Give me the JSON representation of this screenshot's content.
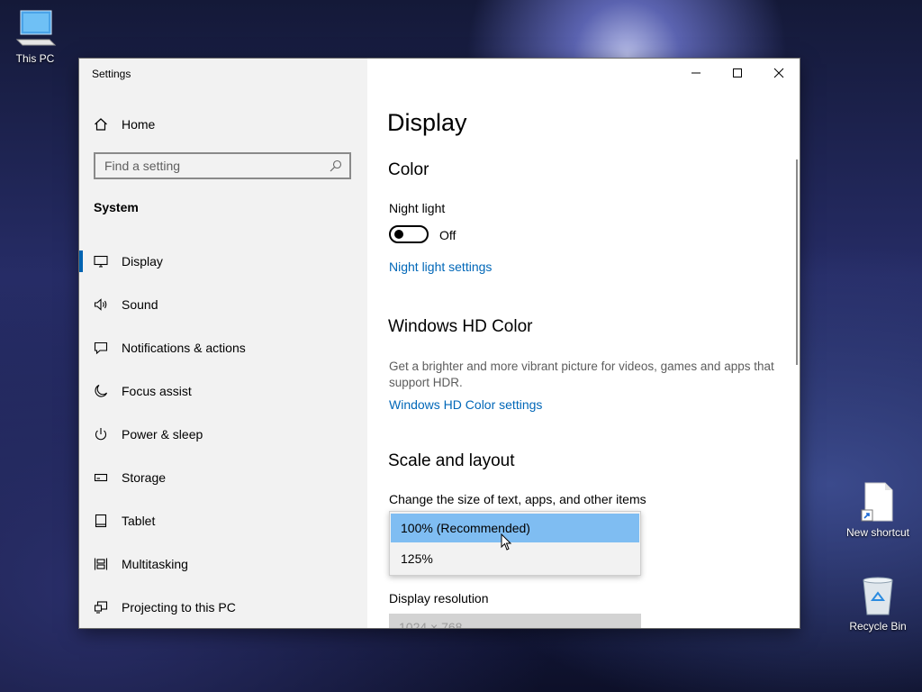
{
  "desktop": {
    "this_pc": "This PC",
    "new_shortcut": "New shortcut",
    "recycle_bin": "Recycle Bin"
  },
  "window": {
    "title": "Settings"
  },
  "sidebar": {
    "home": "Home",
    "search_placeholder": "Find a setting",
    "section": "System",
    "items": [
      {
        "label": "Display",
        "icon": "monitor-icon",
        "active": true
      },
      {
        "label": "Sound",
        "icon": "speaker-icon"
      },
      {
        "label": "Notifications & actions",
        "icon": "message-icon"
      },
      {
        "label": "Focus assist",
        "icon": "moon-icon"
      },
      {
        "label": "Power & sleep",
        "icon": "power-icon"
      },
      {
        "label": "Storage",
        "icon": "storage-icon"
      },
      {
        "label": "Tablet",
        "icon": "tablet-icon"
      },
      {
        "label": "Multitasking",
        "icon": "multitasking-icon"
      },
      {
        "label": "Projecting to this PC",
        "icon": "projector-icon"
      }
    ]
  },
  "content": {
    "title": "Display",
    "color_heading": "Color",
    "night_light_label": "Night light",
    "night_light_state": "Off",
    "night_light_link": "Night light settings",
    "hd_heading": "Windows HD Color",
    "hd_desc": "Get a brighter and more vibrant picture for videos, games and apps that support HDR.",
    "hd_link": "Windows HD Color settings",
    "scale_heading": "Scale and layout",
    "scale_label": "Change the size of text, apps, and other items",
    "scale_options": [
      "100% (Recommended)",
      "125%"
    ],
    "resolution_label": "Display resolution",
    "resolution_value": "1024 × 768"
  },
  "colors": {
    "accent": "#0063b1",
    "link": "#0067b8",
    "selected_option": "#7fbdf2"
  }
}
